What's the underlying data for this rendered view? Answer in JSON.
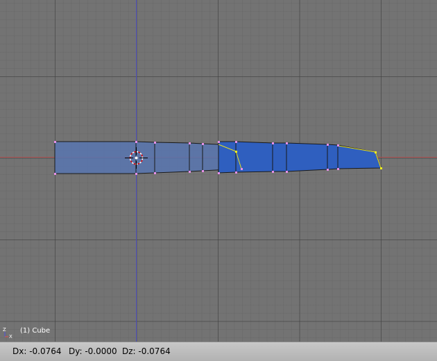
{
  "viewport": {
    "object_label": "(1) Cube",
    "axis_widget": {
      "z": "Z",
      "x": "X"
    },
    "colors": {
      "background": "#737373",
      "x_axis": "#b05050",
      "z_axis": "#5050c0",
      "mesh_face": "#5b7bb3",
      "selected_face": "#2a5ec0",
      "vertex": "#e890e8",
      "selected_vertex": "#f0f020",
      "cursor": "#e00000"
    }
  },
  "header": {
    "dx": "Dx: -0.0764",
    "dy": "Dy: -0.0000",
    "dz": "Dz: -0.0764"
  }
}
